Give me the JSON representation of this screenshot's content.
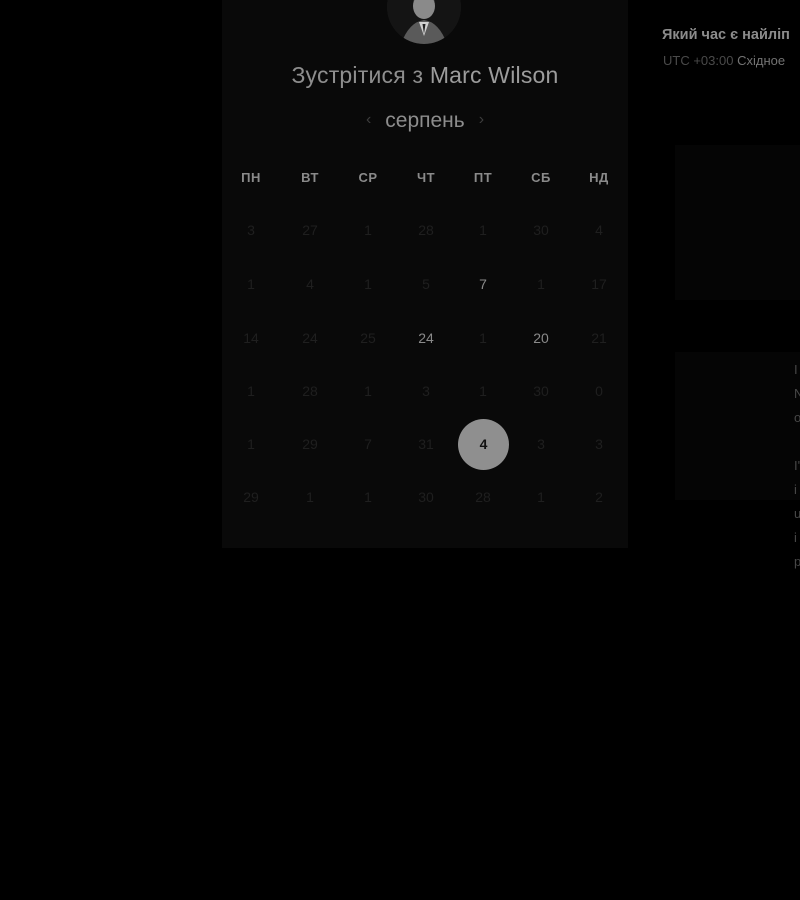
{
  "header": {
    "title_prefix": "Зустрітися з ",
    "host_name": "Marc Wilson"
  },
  "calendar": {
    "month": "серпень",
    "prev_icon": "chevron-left-icon",
    "next_icon": "chevron-right-icon",
    "weekdays": [
      "ПН",
      "ВТ",
      "СР",
      "ЧТ",
      "ПТ",
      "СБ",
      "НД"
    ],
    "weeks": [
      [
        {
          "label": "3",
          "available": false
        },
        {
          "label": "27",
          "available": false
        },
        {
          "label": "1",
          "available": false
        },
        {
          "label": "28",
          "available": false
        },
        {
          "label": "1",
          "available": false
        },
        {
          "label": "30",
          "available": false
        },
        {
          "label": "4",
          "available": false
        }
      ],
      [
        {
          "label": "1",
          "available": false
        },
        {
          "label": "4",
          "available": false
        },
        {
          "label": "1",
          "available": false
        },
        {
          "label": "5",
          "available": false
        },
        {
          "label": "7",
          "available": true
        },
        {
          "label": "1",
          "available": false
        },
        {
          "label": "17",
          "available": false
        }
      ],
      [
        {
          "label": "14",
          "available": false
        },
        {
          "label": "24",
          "available": false
        },
        {
          "label": "25",
          "available": false
        },
        {
          "label": "24",
          "available": true
        },
        {
          "label": "1",
          "available": false
        },
        {
          "label": "20",
          "available": true
        },
        {
          "label": "21",
          "available": false
        }
      ],
      [
        {
          "label": "1",
          "available": false
        },
        {
          "label": "28",
          "available": false
        },
        {
          "label": "1",
          "available": false
        },
        {
          "label": "3",
          "available": false
        },
        {
          "label": "1",
          "available": false
        },
        {
          "label": "30",
          "available": false
        },
        {
          "label": "0",
          "available": false
        }
      ],
      [
        {
          "label": "1",
          "available": false
        },
        {
          "label": "29",
          "available": false
        },
        {
          "label": "7",
          "available": false
        },
        {
          "label": "31",
          "available": false
        },
        {
          "label": "4",
          "available": true,
          "selected": true
        },
        {
          "label": "3",
          "available": false
        },
        {
          "label": "3",
          "available": false
        }
      ],
      [
        {
          "label": "29",
          "available": false
        },
        {
          "label": "1",
          "available": false
        },
        {
          "label": "1",
          "available": false
        },
        {
          "label": "30",
          "available": false
        },
        {
          "label": "28",
          "available": false
        },
        {
          "label": "1",
          "available": false
        },
        {
          "label": "2",
          "available": false
        }
      ]
    ]
  },
  "timezone": {
    "question": "Який час є найліп",
    "offset": "UTC +03:00",
    "name": "Східное"
  },
  "right_fragments": [
    "I",
    "N",
    "o",
    "I'",
    "i",
    "u",
    "i",
    "p"
  ]
}
